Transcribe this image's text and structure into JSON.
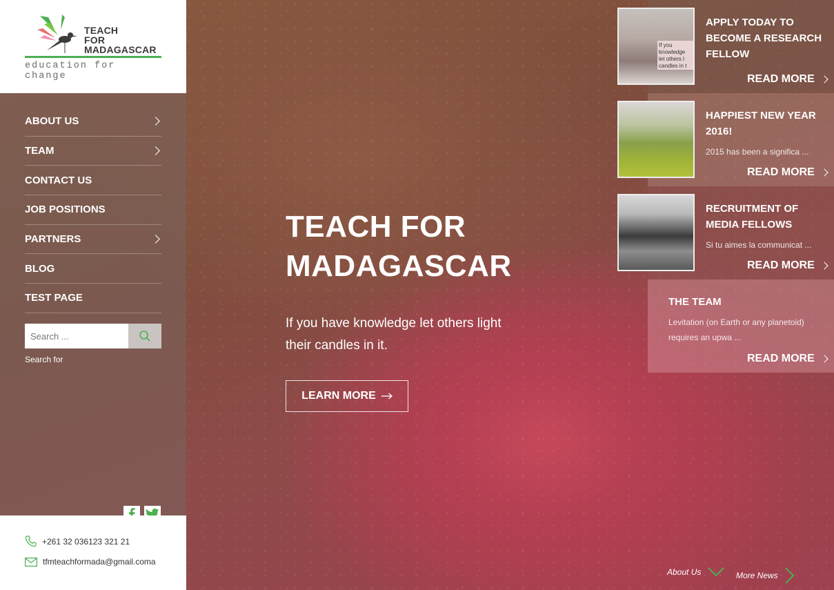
{
  "logo": {
    "line1": "TEACH",
    "line2": "FOR",
    "line3": "MADAGASCAR",
    "tagline": "education for change"
  },
  "nav": {
    "items": [
      {
        "label": "ABOUT US",
        "has_submenu": true
      },
      {
        "label": "TEAM",
        "has_submenu": true
      },
      {
        "label": "CONTACT US",
        "has_submenu": false
      },
      {
        "label": "JOB POSITIONS",
        "has_submenu": false
      },
      {
        "label": "PARTNERS",
        "has_submenu": true
      },
      {
        "label": "BLOG",
        "has_submenu": false
      },
      {
        "label": "TEST PAGE",
        "has_submenu": false
      }
    ]
  },
  "search": {
    "placeholder": "Search ...",
    "label": "Search for"
  },
  "social": {
    "facebook_icon": "facebook-icon",
    "twitter_icon": "twitter-icon"
  },
  "contact": {
    "phone": "+261 32 036123 321 21",
    "email": "tfmteachformada@gmail.coma"
  },
  "hero": {
    "title_line1": "TEACH FOR",
    "title_line2": "MADAGASCAR",
    "subtitle": "If you have knowledge let others light their candles in it.",
    "button_label": "LEARN MORE"
  },
  "news": [
    {
      "title": "APPLY TODAY TO BECOME A RESEARCH FELLOW",
      "excerpt": "",
      "read_more": "READ MORE"
    },
    {
      "title": "HAPPIEST NEW YEAR 2016!",
      "excerpt": "2015 has been a significa ...",
      "read_more": "READ MORE"
    },
    {
      "title": "RECRUITMENT OF MEDIA FELLOWS",
      "excerpt": "Si tu aimes la communicat ...",
      "read_more": "READ MORE"
    },
    {
      "title": "THE TEAM",
      "excerpt": "Levitation (on Earth or any planetoid) requires an upwa ...",
      "read_more": "READ MORE"
    }
  ],
  "thumb1_text": "If you knowledge let others l candles in t",
  "footer_links": {
    "about": "About Us",
    "more_news": "More News"
  },
  "colors": {
    "accent_green": "#4caf50",
    "white": "#ffffff"
  }
}
